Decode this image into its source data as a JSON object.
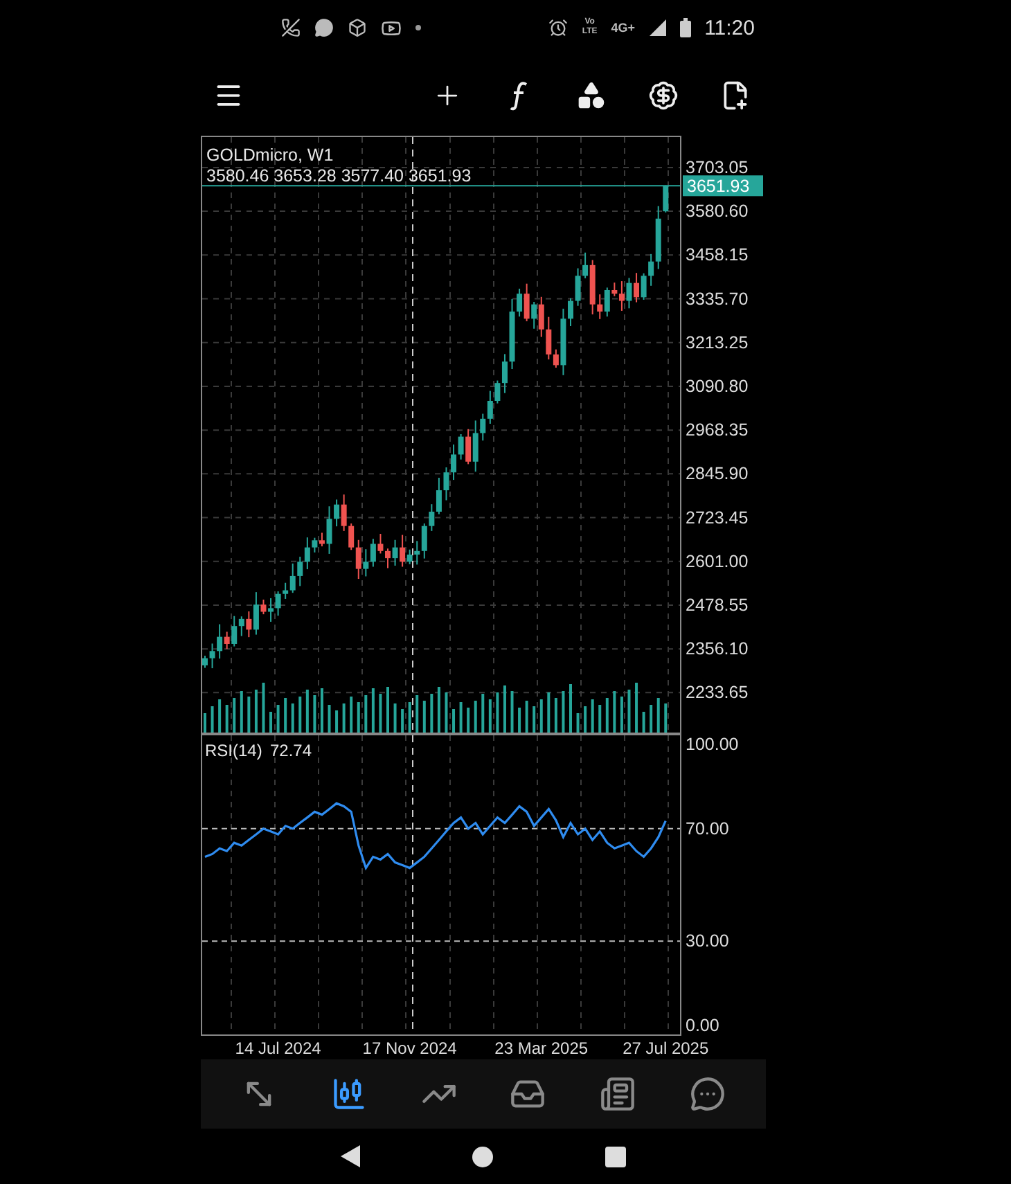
{
  "status_bar": {
    "volte": [
      "Vo",
      "LTE"
    ],
    "network": "4G+",
    "time": "11:20"
  },
  "chart": {
    "title": "GOLDmicro, W1",
    "ohlc_text": "3580.46 3653.28 3577.40 3651.93",
    "last_price": "3651.93",
    "chart_data": {
      "type": "candlestick",
      "ylim": [
        2122,
        3792
      ],
      "grid": true,
      "yticks": [
        {
          "value": 3703.05,
          "label": "3703.05"
        },
        {
          "value": 3580.6,
          "label": "3580.60"
        },
        {
          "value": 3458.15,
          "label": "3458.15"
        },
        {
          "value": 3335.7,
          "label": "3335.70"
        },
        {
          "value": 3213.25,
          "label": "3213.25"
        },
        {
          "value": 3090.8,
          "label": "3090.80"
        },
        {
          "value": 2968.35,
          "label": "2968.35"
        },
        {
          "value": 2845.9,
          "label": "2845.90"
        },
        {
          "value": 2723.45,
          "label": "2723.45"
        },
        {
          "value": 2601,
          "label": "2601.00"
        },
        {
          "value": 2478.55,
          "label": "2478.55"
        },
        {
          "value": 2356.1,
          "label": "2356.10"
        },
        {
          "value": 2233.65,
          "label": "2233.65"
        }
      ],
      "categories": [
        null,
        null,
        null,
        null,
        null,
        null,
        null,
        null,
        null,
        null,
        null,
        null,
        null,
        null,
        null,
        null,
        null,
        null,
        null,
        null,
        null,
        null,
        null,
        null,
        null,
        null,
        null,
        null,
        null,
        null,
        null,
        null,
        null,
        null,
        null,
        null,
        null,
        null,
        null,
        null,
        null,
        null,
        null,
        null,
        null,
        null,
        null,
        null,
        null,
        null,
        null,
        null,
        null,
        null,
        null,
        null,
        null,
        null,
        null,
        null,
        null,
        null,
        null,
        null
      ],
      "ohlc": [
        [
          2310,
          2337,
          2303,
          2330
        ],
        [
          2330,
          2371,
          2302,
          2350
        ],
        [
          2350,
          2425,
          2329,
          2390
        ],
        [
          2390,
          2404,
          2356,
          2370
        ],
        [
          2370,
          2448,
          2363,
          2420
        ],
        [
          2420,
          2447,
          2392,
          2440
        ],
        [
          2440,
          2461,
          2389,
          2410
        ],
        [
          2410,
          2515,
          2396,
          2480
        ],
        [
          2480,
          2494,
          2453,
          2460
        ],
        [
          2460,
          2498,
          2432,
          2470
        ],
        [
          2470,
          2517,
          2449,
          2510
        ],
        [
          2510,
          2541,
          2496,
          2520
        ],
        [
          2520,
          2595,
          2513,
          2560
        ],
        [
          2560,
          2614,
          2532,
          2600
        ],
        [
          2600,
          2668,
          2579,
          2640
        ],
        [
          2640,
          2667,
          2626,
          2660
        ],
        [
          2660,
          2681,
          2643,
          2650
        ],
        [
          2650,
          2755,
          2622,
          2720
        ],
        [
          2720,
          2774,
          2699,
          2760
        ],
        [
          2760,
          2788,
          2686,
          2700
        ],
        [
          2700,
          2707,
          2633,
          2640
        ],
        [
          2640,
          2661,
          2552,
          2580
        ],
        [
          2580,
          2635,
          2559,
          2600
        ],
        [
          2600,
          2664,
          2586,
          2650
        ],
        [
          2650,
          2678,
          2623,
          2630
        ],
        [
          2630,
          2637,
          2582,
          2610
        ],
        [
          2610,
          2661,
          2589,
          2640
        ],
        [
          2640,
          2675,
          2586,
          2600
        ],
        [
          2600,
          2634,
          2593,
          2620
        ],
        [
          2620,
          2658,
          2592,
          2630
        ],
        [
          2630,
          2707,
          2609,
          2700
        ],
        [
          2700,
          2761,
          2686,
          2740
        ],
        [
          2740,
          2835,
          2733,
          2800
        ],
        [
          2800,
          2864,
          2772,
          2850
        ],
        [
          2850,
          2928,
          2829,
          2900
        ],
        [
          2900,
          2957,
          2886,
          2950
        ],
        [
          2950,
          2971,
          2873,
          2880
        ],
        [
          2880,
          2995,
          2852,
          2960
        ],
        [
          2960,
          3014,
          2939,
          3000
        ],
        [
          3000,
          3078,
          2986,
          3050
        ],
        [
          3050,
          3107,
          3043,
          3100
        ],
        [
          3100,
          3181,
          3072,
          3160
        ],
        [
          3160,
          3335,
          3139,
          3300
        ],
        [
          3300,
          3364,
          3286,
          3350
        ],
        [
          3350,
          3378,
          3273,
          3280
        ],
        [
          3280,
          3327,
          3252,
          3320
        ],
        [
          3320,
          3341,
          3229,
          3250
        ],
        [
          3250,
          3285,
          3166,
          3180
        ],
        [
          3180,
          3194,
          3143,
          3150
        ],
        [
          3150,
          3308,
          3122,
          3280
        ],
        [
          3280,
          3337,
          3259,
          3330
        ],
        [
          3330,
          3421,
          3316,
          3400
        ],
        [
          3400,
          3465,
          3393,
          3430
        ],
        [
          3430,
          3444,
          3292,
          3320
        ],
        [
          3320,
          3348,
          3279,
          3300
        ],
        [
          3300,
          3367,
          3286,
          3360
        ],
        [
          3360,
          3381,
          3343,
          3350
        ],
        [
          3350,
          3385,
          3302,
          3330
        ],
        [
          3330,
          3394,
          3309,
          3380
        ],
        [
          3380,
          3408,
          3326,
          3340
        ],
        [
          3340,
          3407,
          3333,
          3400
        ],
        [
          3400,
          3461,
          3372,
          3440
        ],
        [
          3440,
          3595,
          3419,
          3560
        ],
        [
          3580.46,
          3653.28,
          3577.4,
          3651.93
        ]
      ]
    }
  },
  "indicator": {
    "value": "72.74",
    "chart_data": {
      "type": "line",
      "ylim": [
        -3.2,
        103.7
      ],
      "grid": true,
      "yticks": [
        {
          "value": 100,
          "label": "100.00"
        },
        {
          "value": 70,
          "label": "70.00"
        },
        {
          "value": 30,
          "label": "30.00"
        },
        {
          "value": 0,
          "label": "0.00"
        }
      ],
      "categories": [
        null,
        null,
        null,
        null,
        null,
        null,
        null,
        null,
        null,
        null,
        "14 Jul 2024",
        null,
        null,
        null,
        null,
        null,
        null,
        null,
        null,
        null,
        null,
        null,
        null,
        null,
        null,
        null,
        null,
        null,
        "17 Nov 2024",
        null,
        null,
        null,
        null,
        null,
        null,
        null,
        null,
        null,
        null,
        null,
        null,
        null,
        null,
        null,
        null,
        null,
        "23 Mar 2025",
        null,
        null,
        null,
        null,
        null,
        null,
        null,
        null,
        null,
        null,
        null,
        null,
        null,
        null,
        null,
        null,
        "27 Jul 2025"
      ],
      "series": [
        {
          "name": "RSI(14)",
          "color": "#2f8cf0",
          "values": [
            60,
            61,
            63,
            62,
            65,
            64,
            66,
            68,
            70,
            69,
            68,
            71,
            70,
            72,
            74,
            76,
            75,
            77,
            79,
            78,
            76,
            64,
            56,
            60,
            59,
            61,
            58,
            57,
            56,
            58,
            60,
            63,
            66,
            69,
            72,
            74,
            70,
            72,
            68,
            71,
            74,
            72,
            75,
            78,
            76,
            71,
            74,
            77,
            73,
            67,
            72,
            68,
            70,
            66,
            69,
            65,
            63,
            64,
            65,
            62,
            60,
            63,
            67,
            72.74
          ]
        }
      ]
    }
  },
  "bottom_tabs": [
    {
      "kind": "trade",
      "selected": false
    },
    {
      "kind": "chart",
      "selected": true
    },
    {
      "kind": "trend",
      "selected": false
    },
    {
      "kind": "inbox",
      "selected": false
    },
    {
      "kind": "news",
      "selected": false
    },
    {
      "kind": "chat",
      "selected": false
    }
  ]
}
